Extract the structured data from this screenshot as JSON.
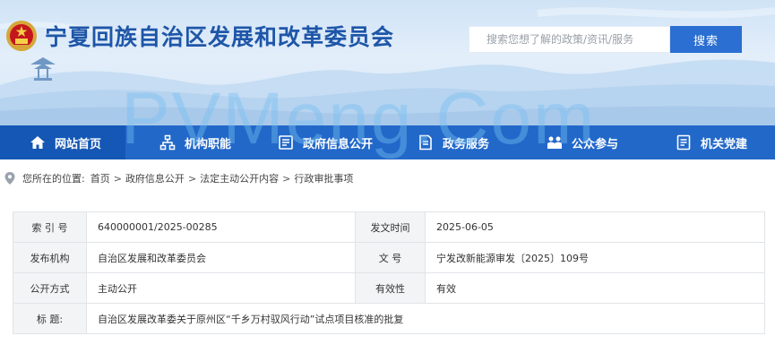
{
  "header": {
    "site_title": "宁夏回族自治区发展和改革委员会",
    "search_placeholder": "搜索您想了解的政策/资讯/服务",
    "search_button": "搜索"
  },
  "nav": {
    "items": [
      {
        "label": "网站首页",
        "icon": "home-icon"
      },
      {
        "label": "机构职能",
        "icon": "org-chart-icon"
      },
      {
        "label": "政府信息公开",
        "icon": "document-list-icon"
      },
      {
        "label": "政务服务",
        "icon": "service-doc-icon"
      },
      {
        "label": "公众参与",
        "icon": "people-icon"
      },
      {
        "label": "机关党建",
        "icon": "party-doc-icon"
      }
    ]
  },
  "breadcrumb": {
    "prefix": "您所在的位置:",
    "items": [
      "首页",
      "政府信息公开",
      "法定主动公开内容",
      "行政审批事项"
    ],
    "separator": ">"
  },
  "info": {
    "index_label": "索 引 号",
    "index_value": "640000001/2025-00285",
    "date_label": "发文时间",
    "date_value": "2025-06-05",
    "issuer_label": "发布机构",
    "issuer_value": "自治区发展和改革委员会",
    "docno_label": "文 号",
    "docno_value": "宁发改新能源审发〔2025〕109号",
    "mode_label": "公开方式",
    "mode_value": "主动公开",
    "validity_label": "有效性",
    "validity_value": "有效",
    "title_label": "标 题:",
    "title_value": "自治区发展改革委关于原州区“千乡万村驭风行动”试点项目核准的批复"
  },
  "watermark": "PVMeng.Com",
  "colors": {
    "nav_bg": "#2268c9",
    "nav_active": "#1457b4",
    "title_blue": "#1e56a8",
    "button_blue": "#2a6fd1"
  }
}
